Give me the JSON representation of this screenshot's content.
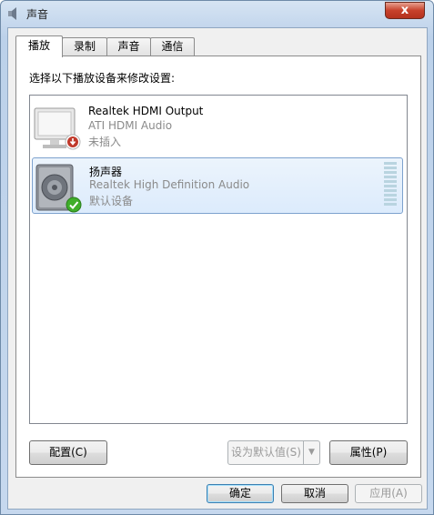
{
  "window": {
    "title": "声音",
    "close_glyph": "x"
  },
  "tabs": [
    {
      "label": "播放",
      "active": true
    },
    {
      "label": "录制",
      "active": false
    },
    {
      "label": "声音",
      "active": false
    },
    {
      "label": "通信",
      "active": false
    }
  ],
  "panel": {
    "instruction": "选择以下播放设备来修改设置:"
  },
  "devices": [
    {
      "name": "Realtek HDMI Output",
      "driver": "ATI HDMI Audio",
      "status": "未插入",
      "icon": "monitor-icon",
      "badge": "unplugged-badge-icon",
      "selected": false
    },
    {
      "name": "扬声器",
      "driver": "Realtek High Definition Audio",
      "status": "默认设备",
      "icon": "speaker-icon",
      "badge": "default-check-icon",
      "selected": true
    }
  ],
  "panel_buttons": {
    "configure": "配置(C)",
    "set_default": "设为默认值(S)",
    "properties": "属性(P)"
  },
  "dialog_buttons": {
    "ok": "确定",
    "cancel": "取消",
    "apply": "应用(A)"
  },
  "colors": {
    "selection": "#dcebfc",
    "check": "#3fae2a",
    "unplugged": "#c0392b"
  }
}
